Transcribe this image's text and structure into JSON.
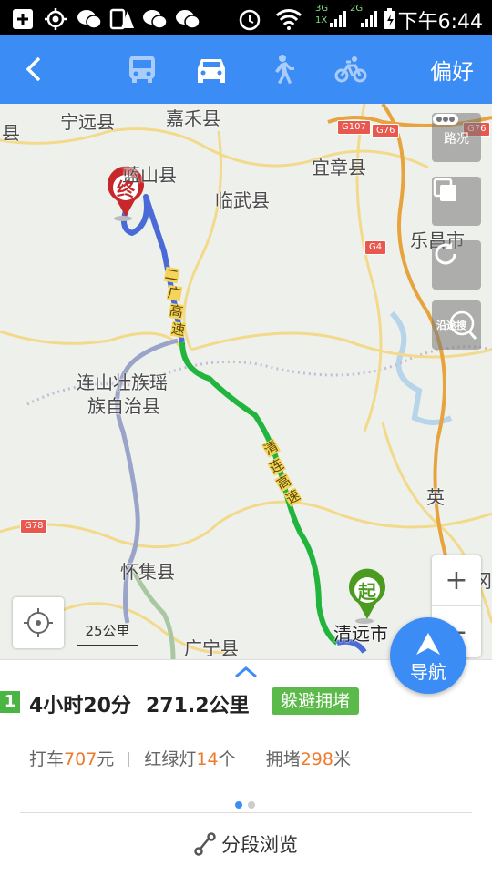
{
  "status_bar": {
    "net_3g": "3G",
    "net_1x": "1X",
    "net_2g": "2G",
    "time": "下午6:44",
    "icons": [
      "add-icon",
      "gps-icon",
      "wechat-icon",
      "clipboard-warning-icon",
      "wechat-icon",
      "wechat-icon",
      "alarm-icon",
      "wifi-icon",
      "signal-icon",
      "signal-icon",
      "battery-icon"
    ]
  },
  "navbar": {
    "back_icon": "back-icon",
    "modes": [
      {
        "name": "bus",
        "icon": "bus-icon",
        "active": false
      },
      {
        "name": "car",
        "icon": "car-icon",
        "active": true
      },
      {
        "name": "walk",
        "icon": "walk-icon",
        "active": false
      },
      {
        "name": "bike",
        "icon": "bike-icon",
        "active": false
      }
    ],
    "preference_label": "偏好"
  },
  "map": {
    "places": [
      {
        "id": "ningyuan",
        "text": "宁远县"
      },
      {
        "id": "jiahe",
        "text": "嘉禾县"
      },
      {
        "id": "yizhang",
        "text": "宜章县"
      },
      {
        "id": "lanshan",
        "text": "蓝山县"
      },
      {
        "id": "linwu",
        "text": "临武县"
      },
      {
        "id": "lechang",
        "text": "乐昌市"
      },
      {
        "id": "lianshan1",
        "text": "连山壮族瑶"
      },
      {
        "id": "lianshan2",
        "text": "族自治县"
      },
      {
        "id": "huaiji",
        "text": "怀集县"
      },
      {
        "id": "guangning",
        "text": "广宁县"
      },
      {
        "id": "qingyuan",
        "text": "清远市"
      },
      {
        "id": "fogang",
        "text": "佛冈"
      },
      {
        "id": "left_xian",
        "text": "县"
      },
      {
        "id": "right_ying",
        "text": "英"
      }
    ],
    "shields": [
      {
        "id": "g107",
        "text": "G107"
      },
      {
        "id": "g76a",
        "text": "G76"
      },
      {
        "id": "g76b",
        "text": "G76"
      },
      {
        "id": "g4",
        "text": "G4"
      },
      {
        "id": "g78",
        "text": "G78"
      }
    ],
    "road_labels": {
      "road1": [
        "二",
        "广",
        "高",
        "速"
      ],
      "road2": [
        "清",
        "连",
        "高",
        "速"
      ]
    },
    "end_marker": "终",
    "start_marker": "起",
    "traffic_label": "路况",
    "along_search_label": "沿途搜",
    "zoom_in": "+",
    "zoom_out": "−",
    "scale": "25公里",
    "route_colors": {
      "fast": "#22b53d",
      "slow": "#4a6ad8",
      "alt": "#9aa3c8"
    }
  },
  "panel": {
    "route_index": "1",
    "duration": "4小时20分",
    "distance": "271.2公里",
    "tag": "躲避拥堵",
    "taxi_prefix": "打车",
    "taxi_value": "707",
    "taxi_unit": "元",
    "lights_prefix": "红绿灯",
    "lights_value": "14",
    "lights_unit": "个",
    "jam_prefix": "拥堵",
    "jam_value": "298",
    "jam_unit": "米",
    "segment_label": "分段浏览",
    "navigate_label": "导航"
  }
}
